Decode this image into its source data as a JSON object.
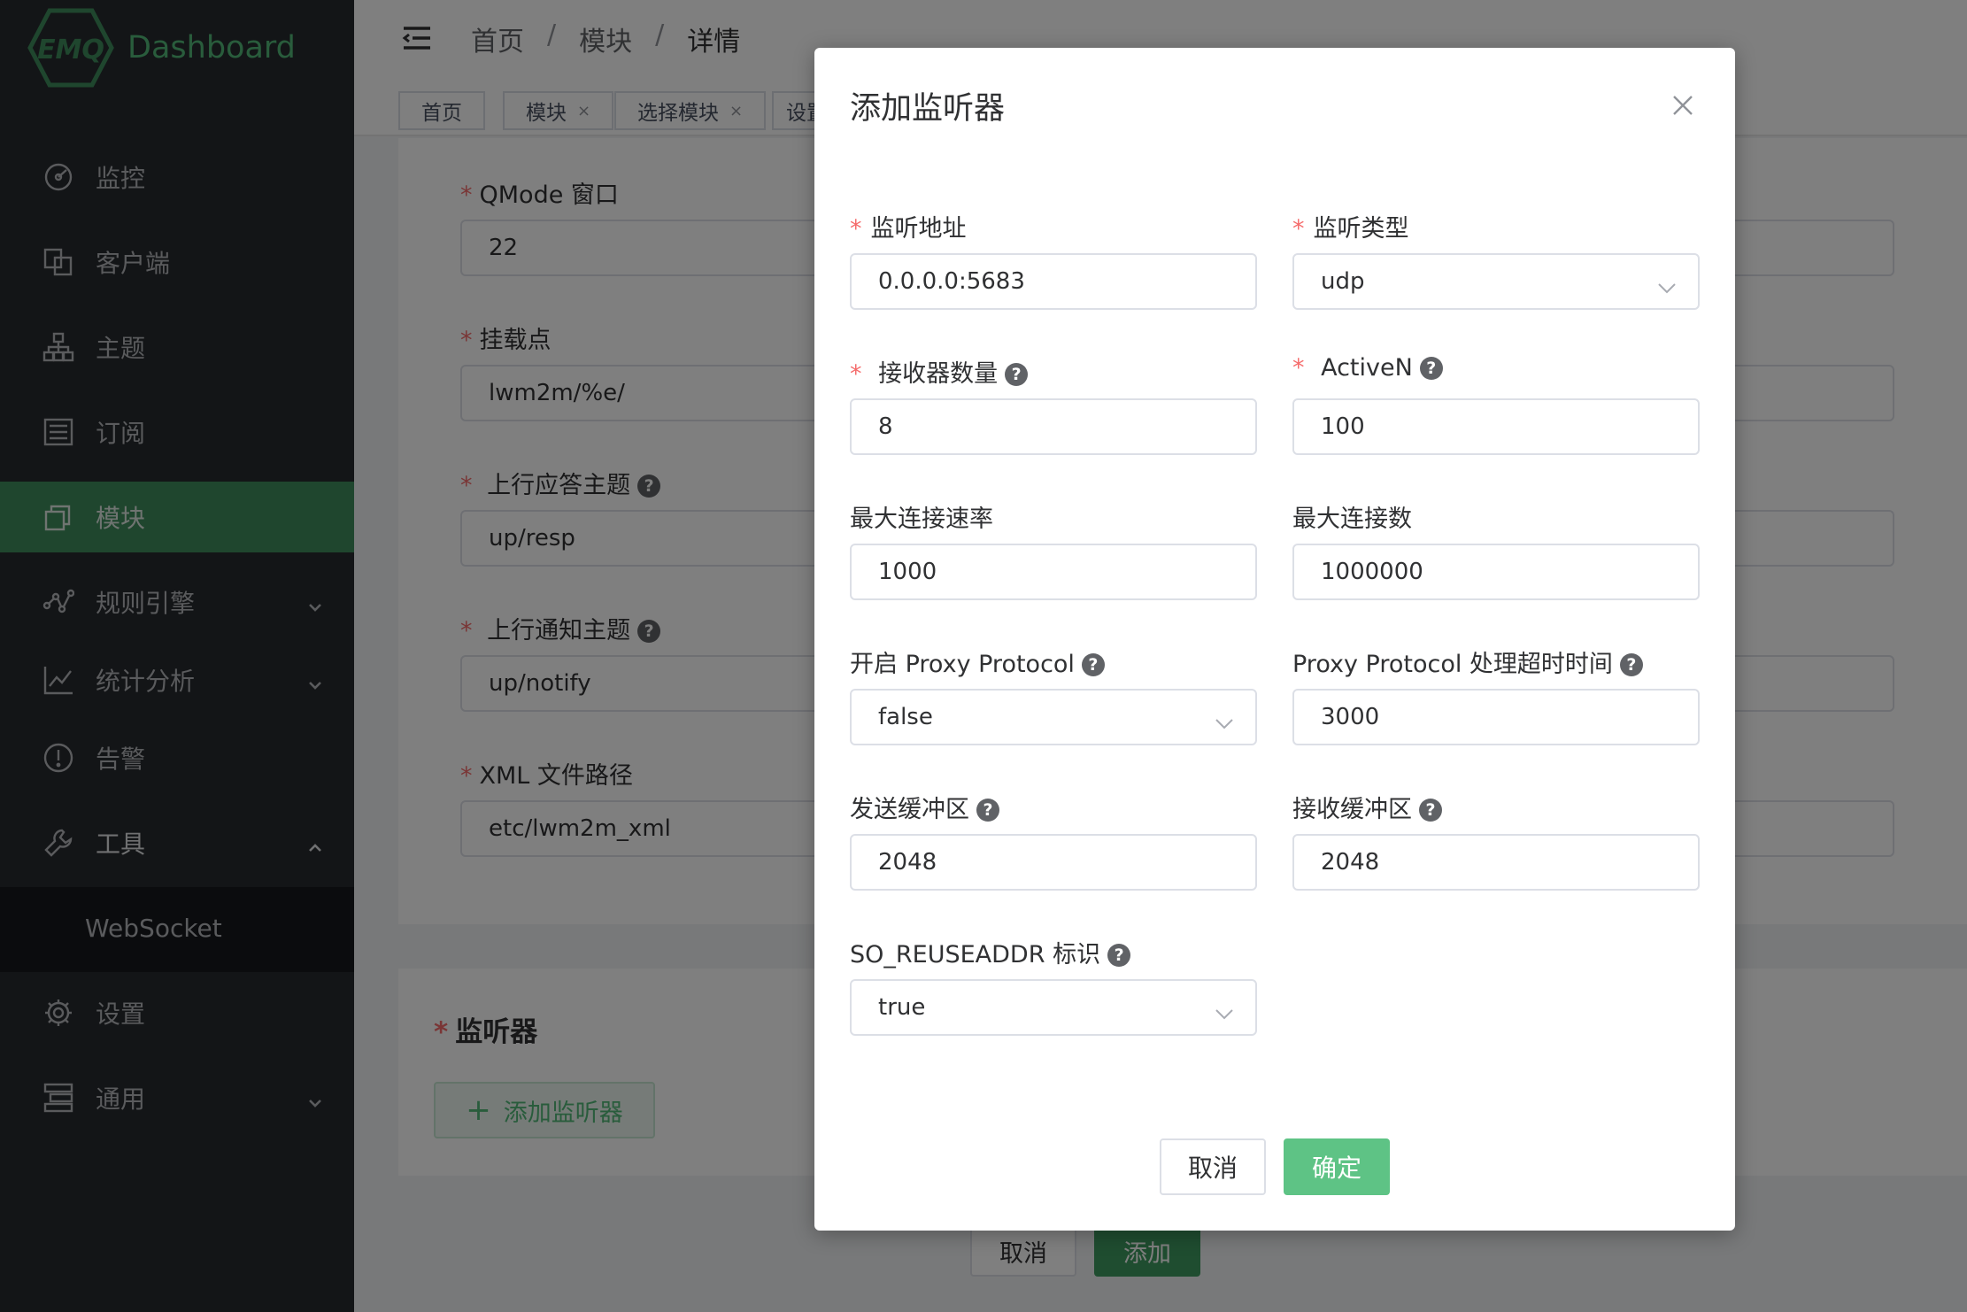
{
  "sidebar": {
    "logo_mark": "EMQ",
    "logo_text": "Dashboard",
    "items": [
      {
        "label": "监控",
        "icon": "dashboard-gauge-icon"
      },
      {
        "label": "客户端",
        "icon": "clients-icon"
      },
      {
        "label": "主题",
        "icon": "topic-tree-icon"
      },
      {
        "label": "订阅",
        "icon": "subscriptions-list-icon"
      },
      {
        "label": "模块",
        "icon": "modules-icon"
      },
      {
        "label": "规则引擎",
        "icon": "rule-engine-icon"
      },
      {
        "label": "统计分析",
        "icon": "analytics-icon"
      },
      {
        "label": "告警",
        "icon": "alarm-icon"
      },
      {
        "label": "工具",
        "icon": "tools-wrench-icon"
      },
      {
        "label": "设置",
        "icon": "settings-gear-icon"
      },
      {
        "label": "通用",
        "icon": "general-icon"
      }
    ],
    "submenu_item": "WebSocket"
  },
  "breadcrumb": [
    "首页",
    "模块",
    "详情"
  ],
  "breadcrumb_sep": "/",
  "tags": [
    {
      "label": "首页"
    },
    {
      "label": "模块",
      "closable": true
    },
    {
      "label": "选择模块",
      "closable": true
    },
    {
      "label": "设置"
    }
  ],
  "bg_form": {
    "fields": [
      {
        "label": "QMode 窗口",
        "value": "22",
        "help": false
      },
      {
        "label": "挂载点",
        "value": "lwm2m/%e/",
        "help": false
      },
      {
        "label": "上行应答主题",
        "value": "up/resp",
        "help": true
      },
      {
        "label": "上行通知主题",
        "value": "up/notify",
        "help": true
      },
      {
        "label": "XML 文件路径",
        "value": "etc/lwm2m_xml",
        "help": false
      }
    ],
    "listener_section_title": "监听器",
    "add_listener_label": "添加监听器",
    "cancel_label": "取消",
    "add_label": "添加"
  },
  "dialog": {
    "title": "添加监听器",
    "fields": [
      {
        "label": "监听地址",
        "value": "0.0.0.0:5683",
        "required": true,
        "help": false,
        "select": false
      },
      {
        "label": "监听类型",
        "value": "udp",
        "required": true,
        "help": false,
        "select": true
      },
      {
        "label": "接收器数量",
        "value": "8",
        "required": true,
        "help": true,
        "select": false
      },
      {
        "label": "ActiveN",
        "value": "100",
        "required": true,
        "help": true,
        "select": false
      },
      {
        "label": "最大连接速率",
        "value": "1000",
        "required": false,
        "help": false,
        "select": false
      },
      {
        "label": "最大连接数",
        "value": "1000000",
        "required": false,
        "help": false,
        "select": false
      },
      {
        "label": "开启 Proxy Protocol",
        "value": "false",
        "required": false,
        "help": true,
        "select": true
      },
      {
        "label": "Proxy Protocol 处理超时时间",
        "value": "3000",
        "required": false,
        "help": true,
        "select": false
      },
      {
        "label": "发送缓冲区",
        "value": "2048",
        "required": false,
        "help": true,
        "select": false
      },
      {
        "label": "接收缓冲区",
        "value": "2048",
        "required": false,
        "help": true,
        "select": false
      },
      {
        "label": "SO_REUSEADDR 标识",
        "value": "true",
        "required": false,
        "help": true,
        "select": true
      }
    ],
    "cancel_label": "取消",
    "confirm_label": "确定"
  },
  "colors": {
    "brand_green": "#52b878",
    "active_menu": "#3f8c5c",
    "sidebar_bg": "#272a2e",
    "required_star": "#f56c6c",
    "primary_button": "#5ec385"
  }
}
